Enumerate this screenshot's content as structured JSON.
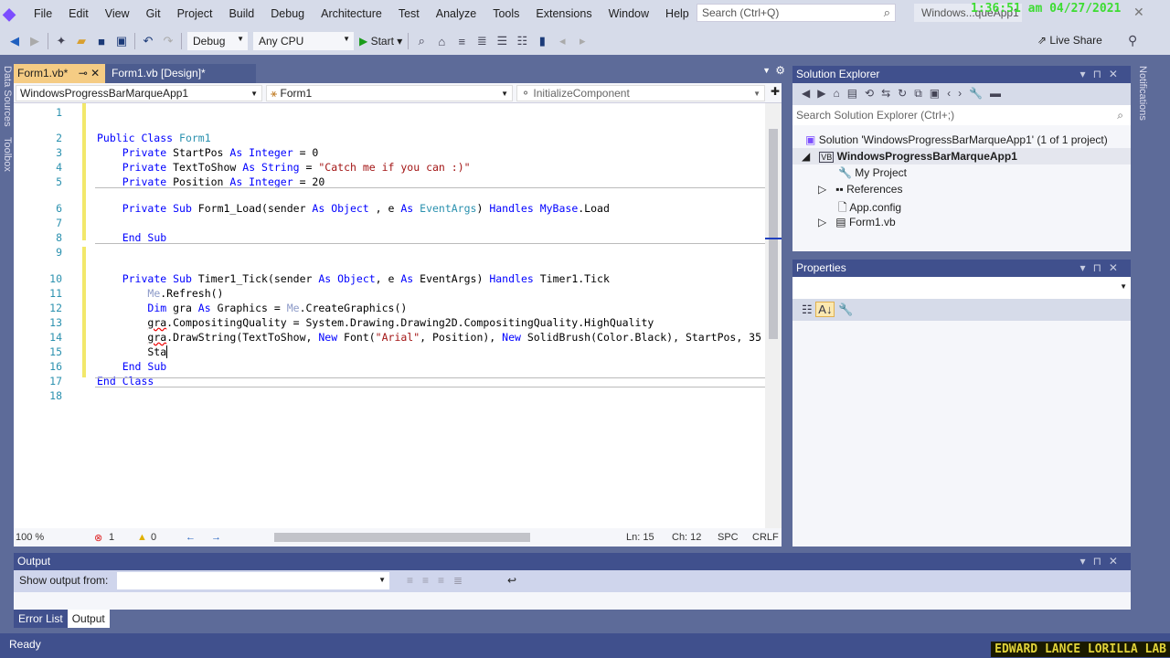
{
  "menu": [
    "File",
    "Edit",
    "View",
    "Git",
    "Project",
    "Build",
    "Debug",
    "Architecture",
    "Test",
    "Analyze",
    "Tools",
    "Extensions",
    "Window",
    "Help"
  ],
  "search": {
    "placeholder": "Search (Ctrl+Q)"
  },
  "window_title": "Windows...queApp1",
  "clock": "1:36:51 am 04/27/2021",
  "toolbar": {
    "config": "Debug",
    "platform": "Any CPU",
    "start": "Start",
    "live_share": "Live Share"
  },
  "left_strip": {
    "data_sources": "Data Sources",
    "toolbox": "Toolbox"
  },
  "right_strip": "Notifications",
  "tabs": [
    {
      "label": "Form1.vb*"
    },
    {
      "label": "Form1.vb [Design]*"
    }
  ],
  "navbar": {
    "project": "WindowsProgressBarMarqueApp1",
    "class": "Form1",
    "member": "InitializeComponent"
  },
  "code": {
    "lines": [
      {
        "n": "1",
        "t": []
      },
      {
        "n": "2",
        "t": [
          [
            "k",
            "Public Class "
          ],
          [
            "t",
            "Form1"
          ]
        ]
      },
      {
        "n": "3",
        "t": [
          [
            "",
            "    "
          ],
          [
            "k",
            "Private "
          ],
          [
            "",
            "StartPos "
          ],
          [
            "k",
            "As Integer "
          ],
          [
            "",
            "= 0"
          ]
        ]
      },
      {
        "n": "4",
        "t": [
          [
            "",
            "    "
          ],
          [
            "k",
            "Private "
          ],
          [
            "",
            "TextToShow "
          ],
          [
            "k",
            "As String "
          ],
          [
            "",
            "= "
          ],
          [
            "s",
            "\"Catch me if you can :)\""
          ]
        ]
      },
      {
        "n": "5",
        "t": [
          [
            "",
            "    "
          ],
          [
            "k",
            "Private "
          ],
          [
            "",
            "Position "
          ],
          [
            "k",
            "As Integer "
          ],
          [
            "",
            "= 20"
          ]
        ]
      },
      {
        "n": "6",
        "t": [
          [
            "",
            "    "
          ],
          [
            "k",
            "Private Sub "
          ],
          [
            "",
            "Form1_Load(sender "
          ],
          [
            "k",
            "As Object"
          ],
          [
            "",
            " , e "
          ],
          [
            "k",
            "As "
          ],
          [
            "t",
            "EventArgs"
          ],
          [
            "",
            ") "
          ],
          [
            "k",
            "Handles "
          ],
          [
            "k",
            "MyBase"
          ],
          [
            "",
            ".Load"
          ]
        ]
      },
      {
        "n": "7",
        "t": []
      },
      {
        "n": "8",
        "t": [
          [
            "",
            "    "
          ],
          [
            "k",
            "End Sub"
          ]
        ]
      },
      {
        "n": "9",
        "t": []
      },
      {
        "n": "10",
        "t": [
          [
            "",
            "    "
          ],
          [
            "k",
            "Private Sub "
          ],
          [
            "",
            "Timer1_Tick(sender "
          ],
          [
            "k",
            "As Object"
          ],
          [
            "",
            ", e "
          ],
          [
            "k",
            "As "
          ],
          [
            "",
            "EventArgs) "
          ],
          [
            "k",
            "Handles "
          ],
          [
            "",
            "Timer1.Tick"
          ]
        ]
      },
      {
        "n": "11",
        "t": [
          [
            "",
            "        "
          ],
          [
            "m",
            "Me"
          ],
          [
            "",
            ".Refresh()"
          ]
        ]
      },
      {
        "n": "12",
        "t": [
          [
            "",
            "        "
          ],
          [
            "k",
            "Dim "
          ],
          [
            "",
            "gra "
          ],
          [
            "k",
            "As "
          ],
          [
            "",
            "Graphics = "
          ],
          [
            "m",
            "Me"
          ],
          [
            "",
            ".CreateGraphics()"
          ]
        ]
      },
      {
        "n": "13",
        "t": [
          [
            "",
            "        "
          ],
          [
            "e",
            "gra"
          ],
          [
            "",
            ".CompositingQuality = System.Drawing.Drawing2D.CompositingQuality.HighQuality"
          ]
        ]
      },
      {
        "n": "14",
        "t": [
          [
            "",
            "        "
          ],
          [
            "e",
            "gra"
          ],
          [
            "",
            ".DrawString(TextToShow, "
          ],
          [
            "k",
            "New "
          ],
          [
            "",
            "Font("
          ],
          [
            "s",
            "\"Arial\""
          ],
          [
            "",
            ", Position), "
          ],
          [
            "k",
            "New "
          ],
          [
            "",
            "SolidBrush(Color.Black), StartPos, 35"
          ]
        ]
      },
      {
        "n": "15",
        "t": [
          [
            "",
            "        Sta"
          ]
        ]
      },
      {
        "n": "16",
        "t": [
          [
            "",
            "    "
          ],
          [
            "k",
            "End Sub"
          ]
        ]
      },
      {
        "n": "17",
        "t": [
          [
            "k",
            "End Class"
          ]
        ]
      },
      {
        "n": "18",
        "t": []
      }
    ]
  },
  "editor_status": {
    "zoom": "100 %",
    "errors": "1",
    "warnings": "0",
    "line": "Ln: 15",
    "col": "Ch: 12",
    "spacing": "SPC",
    "eol": "CRLF"
  },
  "solution_explorer": {
    "title": "Solution Explorer",
    "search_placeholder": "Search Solution Explorer (Ctrl+;)",
    "items": [
      {
        "label": "Solution 'WindowsProgressBarMarqueApp1' (1 of 1 project)"
      },
      {
        "label": "WindowsProgressBarMarqueApp1"
      },
      {
        "label": "My Project"
      },
      {
        "label": "References"
      },
      {
        "label": "App.config"
      },
      {
        "label": "Form1.vb"
      }
    ]
  },
  "properties": {
    "title": "Properties"
  },
  "output": {
    "title": "Output",
    "show_from": "Show output from:"
  },
  "bottom_tabs": [
    "Error List",
    "Output"
  ],
  "status": "Ready",
  "watermark": "EDWARD LANCE LORILLA LAB"
}
